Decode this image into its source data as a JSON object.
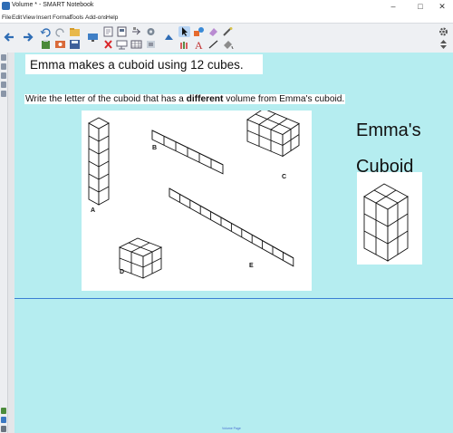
{
  "window": {
    "title": "Volume * - SMART Notebook"
  },
  "menu": [
    "File",
    "Edit",
    "View",
    "Insert",
    "Format",
    "Tools",
    "Add-ons",
    "Help"
  ],
  "window_controls": {
    "minimize": "–",
    "maximize": "□",
    "close": "✕"
  },
  "toolbar": {
    "icons": [
      "back-icon",
      "forward-icon",
      "undo-icon",
      "redo-icon",
      "open-icon",
      "save-icon",
      "paste-icon",
      "delete-icon",
      "screen-shade-icon",
      "table-icon",
      "document-camera-icon",
      "select-icon",
      "pen-icon",
      "eraser-icon",
      "line-icon",
      "shapes-icon",
      "text-icon",
      "fill-icon",
      "properties-icon"
    ],
    "accent": "#2f6db5"
  },
  "page": {
    "heading": "Emma makes a cuboid using 12 cubes.",
    "question_before": "Write the letter of the cuboid that has a ",
    "question_bold": "different",
    "question_after": " volume from Emma's cuboid.",
    "figure_labels": [
      "A",
      "B",
      "C",
      "D",
      "E"
    ],
    "emma_line1": "Emma's",
    "emma_line2": "Cuboid",
    "footer": "Volume Page"
  },
  "colors": {
    "canvas": "#b5edf0",
    "divider": "#3b7fd3"
  }
}
